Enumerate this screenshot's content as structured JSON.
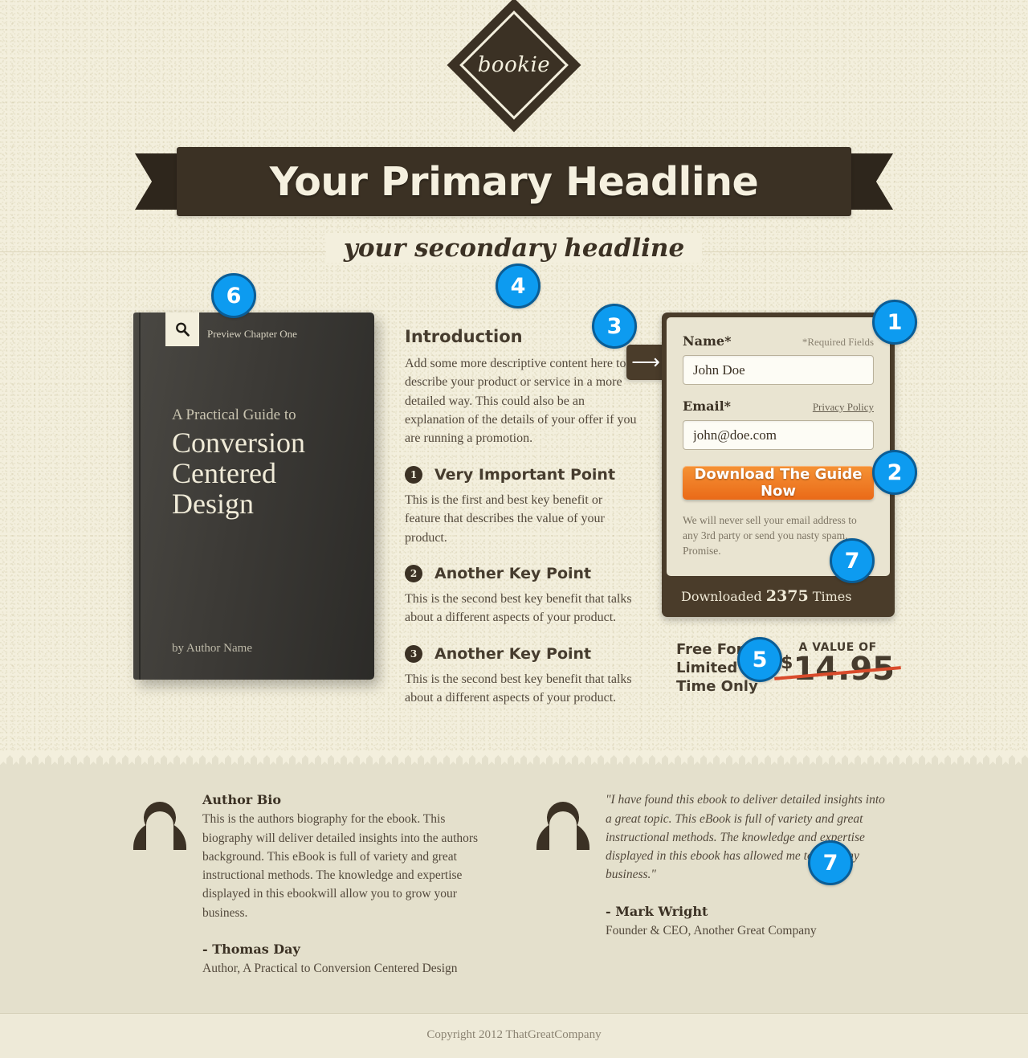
{
  "brand": {
    "logo_text": "bookie"
  },
  "header": {
    "primary_headline": "Your Primary Headline",
    "secondary_headline": "your secondary headline"
  },
  "book": {
    "preview_label": "Preview Chapter One",
    "preview_icon": "search-icon",
    "kicker": "A Practical Guide to",
    "title": "Conversion Centered Design",
    "author": "by Author Name"
  },
  "copy": {
    "heading": "Introduction",
    "intro": "Add some more descriptive content here to describe your product or service in a more detailed way. This could also be an explanation of the details of your offer if you are running a promotion.",
    "points": [
      {
        "number": "1",
        "title": "Very Important Point",
        "body": "This is the first and best key benefit or feature that describes the value of your product."
      },
      {
        "number": "2",
        "title": "Another Key Point",
        "body": "This is the second best key benefit that talks about a different aspects of your product."
      },
      {
        "number": "3",
        "title": "Another Key Point",
        "body": "This is the second best key benefit that talks about a different aspects of your product."
      }
    ]
  },
  "form": {
    "arrow_icon": "arrow-right-icon",
    "name_label": "Name*",
    "required_note": "*Required Fields",
    "name_value": "John Doe",
    "name_placeholder": "John Doe",
    "email_label": "Email*",
    "privacy_link": "Privacy Policy",
    "email_value": "john@doe.com",
    "email_placeholder": "john@doe.com",
    "cta_label": "Download The Guide Now",
    "promise": "We will never sell your email address to any 3rd party or send you nasty spam. Promise.",
    "downloaded_prefix": "Downloaded ",
    "downloaded_count": "2375",
    "downloaded_suffix": " Times"
  },
  "price": {
    "free_text": "Free For A Limited Time Only",
    "value_kicker": "A VALUE OF",
    "currency": "$",
    "amount": "14.95"
  },
  "badges": {
    "b1": "1",
    "b2": "2",
    "b3": "3",
    "b4": "4",
    "b5": "5",
    "b6": "6",
    "b7": "7",
    "b7b": "7"
  },
  "author_bio": {
    "heading": "Author Bio",
    "body": "This is the authors biography for the ebook. This biography will deliver detailed insights into the authors background. This eBook is full of variety and great instructional methods. The knowledge and expertise displayed in this ebookwill allow you to grow your business.",
    "name": "- Thomas Day",
    "role": "Author, A Practical to Conversion Centered Design"
  },
  "testimonial": {
    "quote": "\"I have found this ebook to deliver detailed insights into a great topic. This eBook is full of variety and great instructional methods. The knowledge and expertise displayed in this ebook has allowed me to grow my business.\"",
    "name": "- Mark Wright",
    "role": "Founder & CEO, Another Great Company"
  },
  "footer": {
    "copyright": "Copyright 2012 ThatGreatCompany"
  },
  "colors": {
    "page_bg": "#f3efdd",
    "dark_brown": "#3b3124",
    "form_brown": "#4a3c2a",
    "cta_orange": "#ea6a18",
    "badge_blue": "#0d9bf0",
    "badge_ring": "#0a5d96",
    "strike_red": "#d94b2b",
    "bottom_band": "#e4e0cc"
  }
}
